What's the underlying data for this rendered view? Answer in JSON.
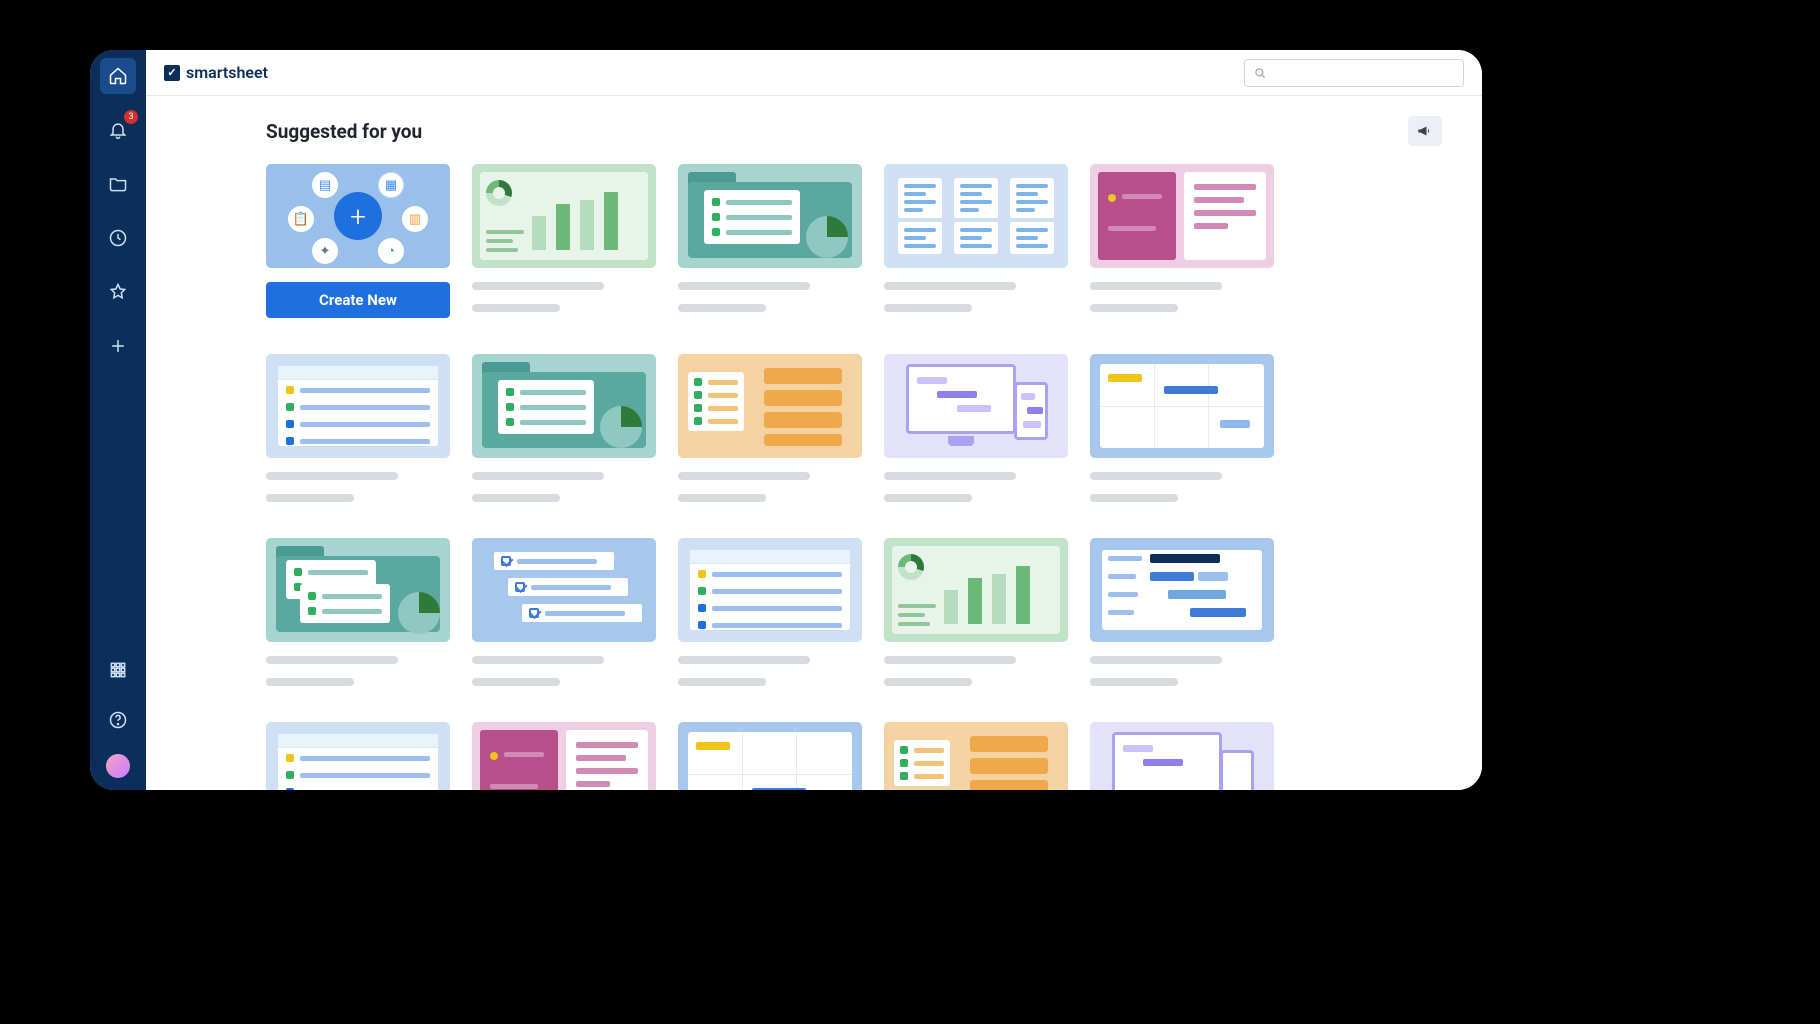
{
  "brand": {
    "name": "smartsheet",
    "mark": "✓"
  },
  "sidebar": {
    "notification_count": "3"
  },
  "header": {
    "title": "Suggested for you"
  },
  "actions": {
    "create_label": "Create New"
  },
  "search": {
    "placeholder": ""
  }
}
